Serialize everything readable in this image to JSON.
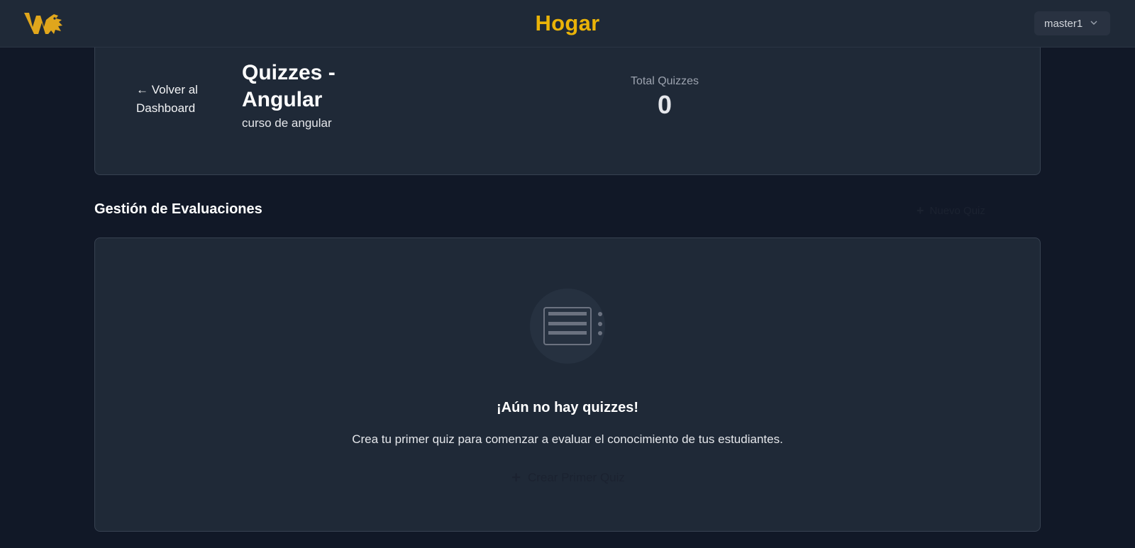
{
  "app": {
    "title": "Hogar",
    "brand_color": "#eab308",
    "logo": "dragon-logo-icon"
  },
  "user_menu": {
    "username": "master1",
    "icon": "chevron-down-icon"
  },
  "header": {
    "back_arrow": "←",
    "back_label": "Volver al Dashboard",
    "title": "Quizzes - Angular",
    "subtitle": "curso de angular",
    "stat_label": "Total Quizzes",
    "stat_value": "0"
  },
  "section": {
    "title": "Gestión de Evaluaciones",
    "new_button_label": "Nuevo Quiz",
    "new_button_icon": "plus-icon"
  },
  "empty_state": {
    "icon": "quiz-list-icon",
    "title": "¡Aún no hay quizzes!",
    "description": "Crea tu primer quiz para comenzar a evaluar el conocimiento de tus estudiantes.",
    "button_label": "Crear Primer Quiz",
    "button_icon": "plus-icon"
  },
  "colors": {
    "background": "#111827",
    "card": "#1f2937",
    "border": "#374151"
  }
}
